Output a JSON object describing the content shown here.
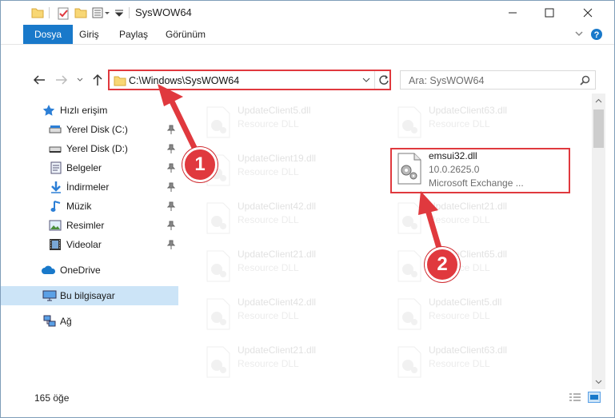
{
  "window": {
    "title": "SysWOW64"
  },
  "ribbon": {
    "tabs": [
      "Dosya",
      "Giriş",
      "Paylaş",
      "Görünüm"
    ]
  },
  "address": {
    "path": "C:\\Windows\\SysWOW64"
  },
  "search": {
    "placeholder": "Ara: SysWOW64"
  },
  "sidebar": {
    "quick_access": "Hızlı erişim",
    "items": [
      {
        "label": "Yerel Disk (C:)",
        "icon": "drive-icon"
      },
      {
        "label": "Yerel Disk (D:)",
        "icon": "drive-icon"
      },
      {
        "label": "Belgeler",
        "icon": "documents-icon"
      },
      {
        "label": "İndirmeler",
        "icon": "downloads-icon"
      },
      {
        "label": "Müzik",
        "icon": "music-icon"
      },
      {
        "label": "Resimler",
        "icon": "pictures-icon"
      },
      {
        "label": "Videolar",
        "icon": "videos-icon"
      }
    ],
    "onedrive": "OneDrive",
    "this_pc": "Bu bilgisayar",
    "network": "Ağ"
  },
  "files": {
    "left": [
      {
        "name": "UpdateClient5.dll",
        "desc": "Resource DLL"
      },
      {
        "name": "UpdateClient19.dll",
        "desc": "Resource DLL"
      },
      {
        "name": "UpdateClient42.dll",
        "desc": "Resource DLL"
      },
      {
        "name": "UpdateClient21.dll",
        "desc": "Resource DLL"
      },
      {
        "name": "UpdateClient42.dll",
        "desc": "Resource DLL"
      },
      {
        "name": "UpdateClient21.dll",
        "desc": "Resource DLL"
      }
    ],
    "right": [
      {
        "name": "UpdateClient63.dll",
        "desc": "Resource DLL"
      },
      {
        "name": "UpdateClient21.dll",
        "desc": "Resource DLL"
      },
      {
        "name": "UpdateClient65.dll",
        "desc": "Resource DLL"
      },
      {
        "name": "UpdateClient5.dll",
        "desc": "Resource DLL"
      },
      {
        "name": "UpdateClient63.dll",
        "desc": "Resource DLL"
      }
    ],
    "selected": {
      "name": "emsui32.dll",
      "version": "10.0.2625.0",
      "company": "Microsoft Exchange ..."
    }
  },
  "annotations": {
    "badge1": "1",
    "badge2": "2"
  },
  "status": {
    "count": "165 öğe"
  },
  "colors": {
    "accent": "#1979ca",
    "annotation": "#e0393e"
  }
}
